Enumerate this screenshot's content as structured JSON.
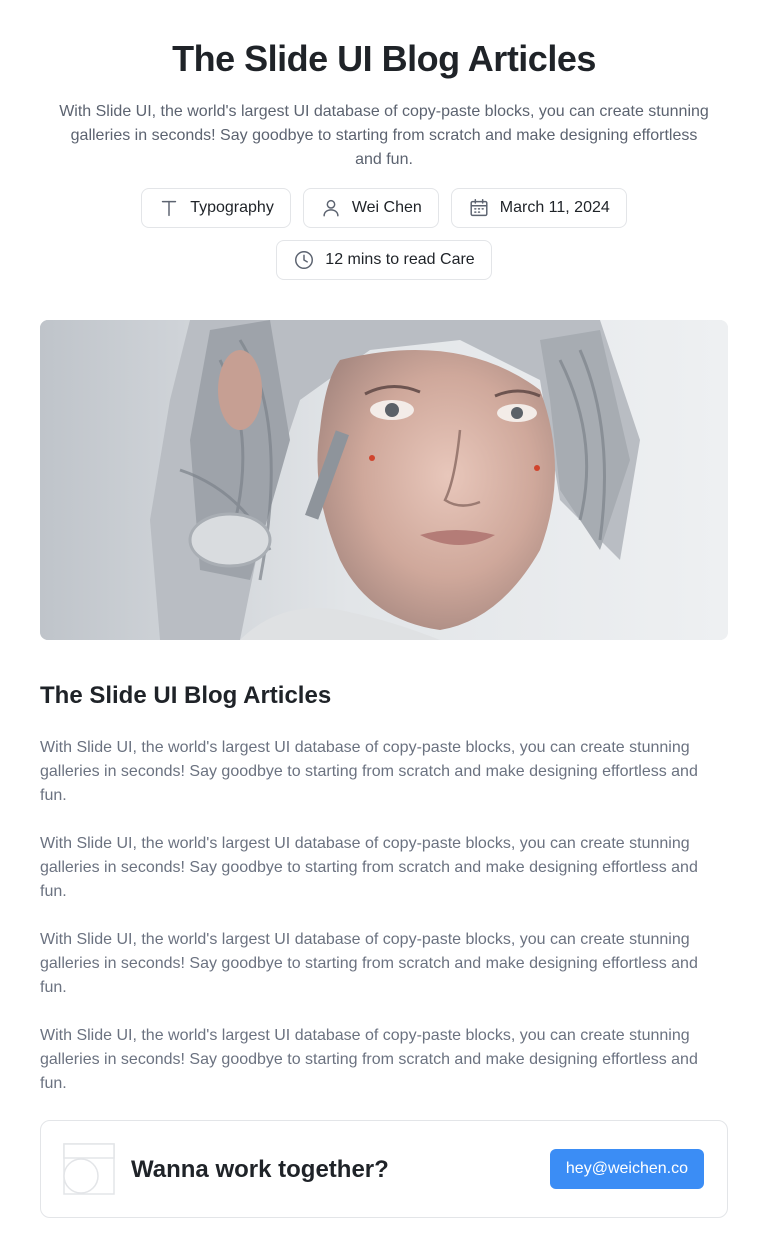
{
  "header": {
    "title": "The Slide UI Blog Articles",
    "subtitle": "With Slide UI, the world's largest UI database of copy-paste blocks, you can create stunning galleries in seconds! Say goodbye to starting from scratch and make designing effortless and fun."
  },
  "meta_chips": [
    {
      "icon": "typography-icon",
      "label": "Typography"
    },
    {
      "icon": "user-icon",
      "label": "Wei Chen"
    },
    {
      "icon": "calendar-icon",
      "label": "March 11, 2024"
    },
    {
      "icon": "clock-icon",
      "label": "12 mins to read Care"
    }
  ],
  "hero_image": {
    "subject": "robotic-woman-portrait"
  },
  "article": {
    "title": "The Slide UI Blog Articles",
    "paragraphs": [
      "With Slide UI, the world's largest UI database of copy-paste blocks, you can create stunning galleries in seconds! Say goodbye to starting from scratch and make designing effortless and fun.",
      "With Slide UI, the world's largest UI database of copy-paste blocks, you can create stunning galleries in seconds! Say goodbye to starting from scratch and make designing effortless and fun.",
      "With Slide UI, the world's largest UI database of copy-paste blocks, you can create stunning galleries in seconds! Say goodbye to starting from scratch and make designing effortless and fun.",
      "With Slide UI, the world's largest UI database of copy-paste blocks, you can create stunning galleries in seconds! Say goodbye to starting from scratch and make designing effortless and fun."
    ]
  },
  "cta": {
    "heading": "Wanna work together?",
    "button_label": "hey@weichen.co",
    "logo_icon": "brand-logo-icon"
  },
  "colors": {
    "text_primary": "#1f2328",
    "text_muted": "#6b7280",
    "border": "#e3e5e8",
    "accent": "#3b8df5"
  }
}
